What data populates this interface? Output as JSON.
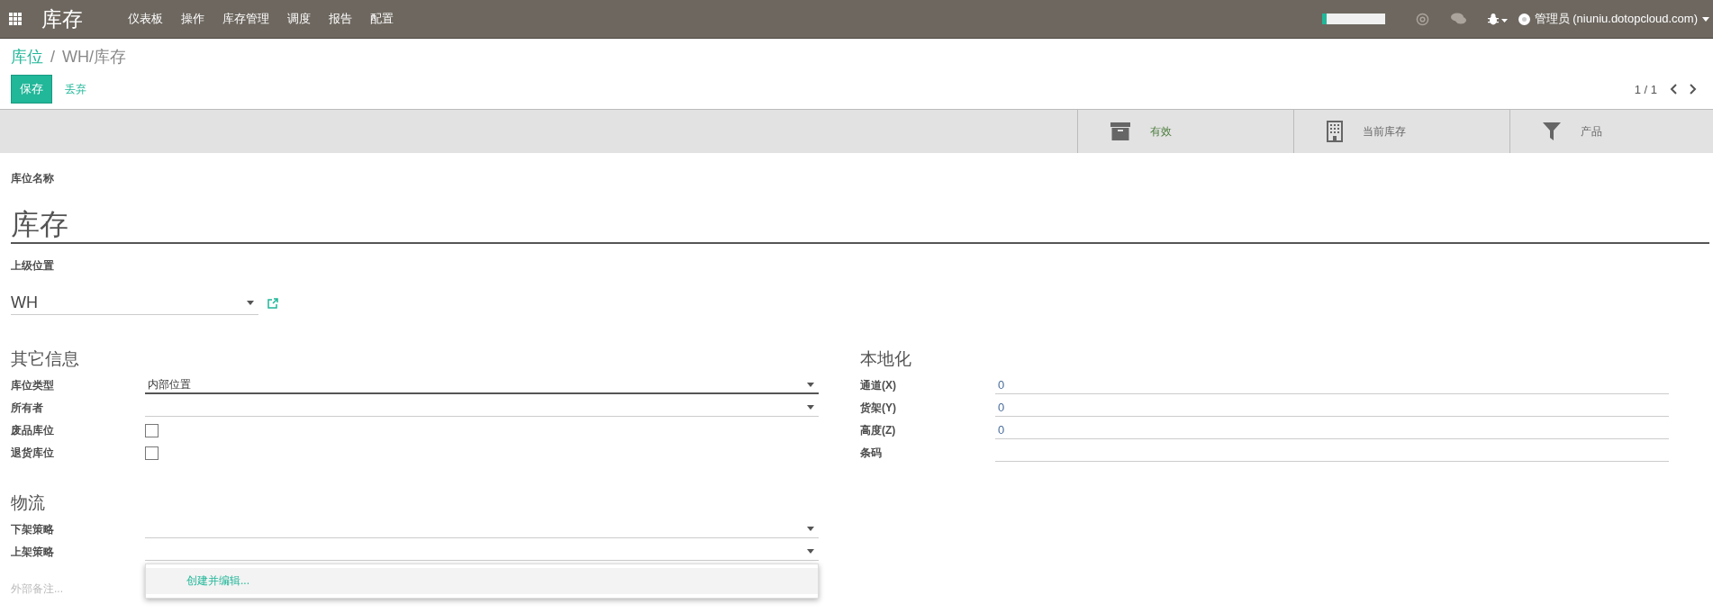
{
  "topbar": {
    "app_title": "库存",
    "menu": [
      "仪表板",
      "操作",
      "库存管理",
      "调度",
      "报告",
      "配置"
    ],
    "meter": {
      "level": 0.08
    },
    "user": "管理员 (niuniu.dotopcloud.com)"
  },
  "breadcrumb": {
    "parent": "库位",
    "separator": "/",
    "current": "WH/库存"
  },
  "buttons": {
    "save": "保存",
    "discard": "丢弃"
  },
  "pager": "1 / 1",
  "stat_buttons": [
    {
      "kind": "archive",
      "label": "有效",
      "on": true
    },
    {
      "kind": "building",
      "label": "当前库存",
      "on": false
    },
    {
      "kind": "filter",
      "label": "产品",
      "on": false
    }
  ],
  "form": {
    "name_label": "库位名称",
    "name": "库存",
    "name_required": true,
    "parent_label": "上级位置",
    "parent": "WH",
    "left_group": {
      "title": "其它信息",
      "fields": [
        {
          "kind": "select",
          "label": "库位类型",
          "value": "内部位置",
          "required": true
        },
        {
          "kind": "select",
          "label": "所有者",
          "required": false
        },
        {
          "kind": "checkbox",
          "label": "废品库位",
          "checked": false
        },
        {
          "kind": "checkbox",
          "label": "退货库位",
          "checked": false
        }
      ]
    },
    "right_group": {
      "title": "本地化",
      "fields": [
        {
          "kind": "text",
          "label": "通道(X)",
          "value": "0"
        },
        {
          "kind": "text",
          "label": "货架(Y)",
          "value": "0"
        },
        {
          "kind": "text",
          "label": "高度(Z)",
          "value": "0"
        },
        {
          "kind": "text",
          "label": "条码"
        }
      ]
    },
    "logistics_group": {
      "title": "物流",
      "fields": [
        {
          "kind": "select",
          "label": "下架策略",
          "required": false
        },
        {
          "kind": "select",
          "label": "上架策略",
          "required": false
        }
      ]
    },
    "dropdown": [
      {
        "label": "创建并编辑...",
        "selected": true
      }
    ],
    "note_placeholder": "外部备注..."
  }
}
